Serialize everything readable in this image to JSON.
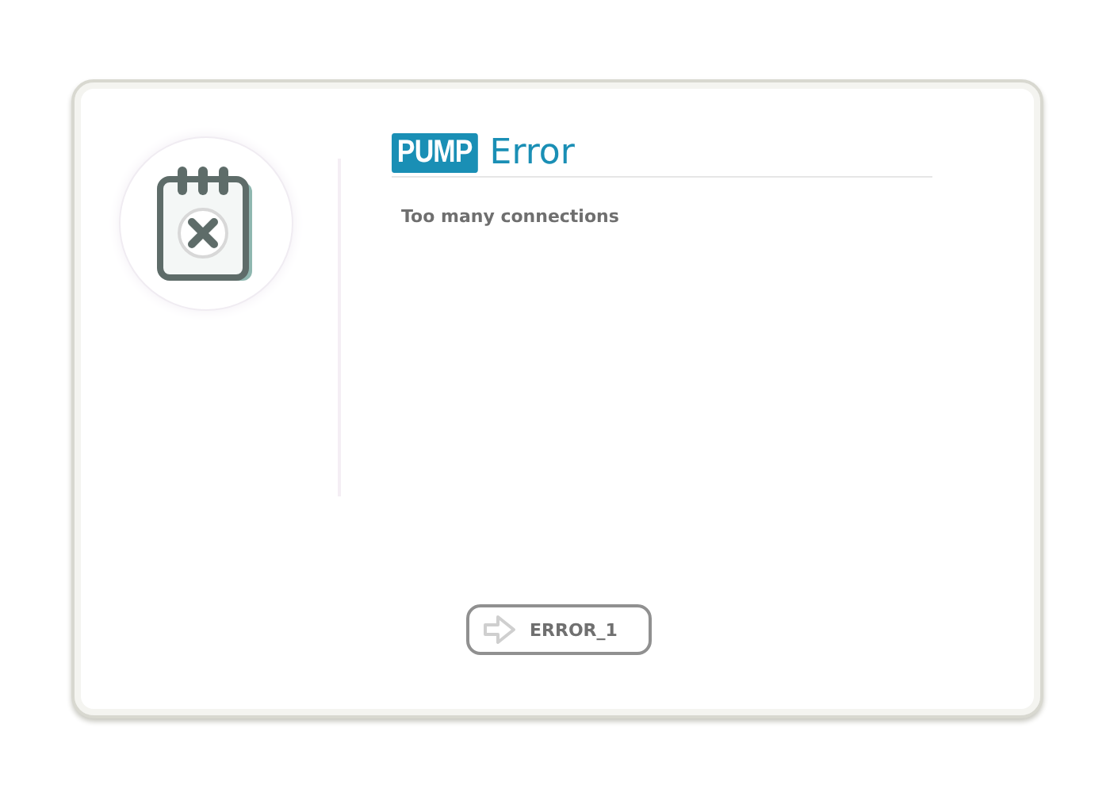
{
  "header": {
    "logo": "PUMP",
    "title": "Error"
  },
  "message": "Too many connections",
  "button": {
    "label": "ERROR_1"
  }
}
